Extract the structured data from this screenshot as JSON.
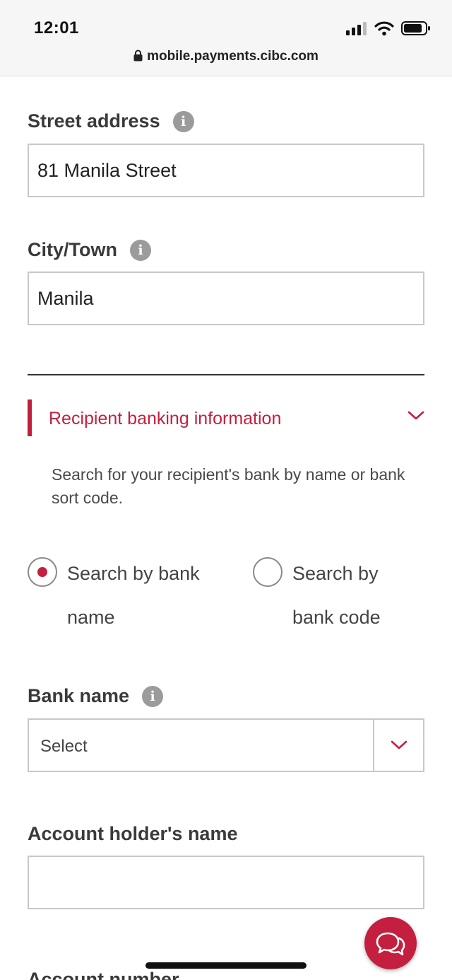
{
  "status_bar": {
    "time": "12:01"
  },
  "browser": {
    "url": "mobile.payments.cibc.com"
  },
  "form": {
    "street_address": {
      "label": "Street address",
      "value": "81 Manila Street"
    },
    "city_town": {
      "label": "City/Town",
      "value": "Manila"
    },
    "section": {
      "title": "Recipient banking information"
    },
    "helper_text": "Search for your recipient's bank by name or bank sort code.",
    "search_options": [
      {
        "label_line1": "Search by bank",
        "label_line2": "name",
        "selected": true
      },
      {
        "label_line1": "Search by",
        "label_line2": "bank code",
        "selected": false
      }
    ],
    "bank_name": {
      "label": "Bank name",
      "selected_value": "Select"
    },
    "account_holder": {
      "label": "Account holder's name",
      "value": ""
    },
    "account_number": {
      "label": "Account number"
    }
  },
  "icons": {
    "info": "info-icon",
    "chevron": "chevron-down-icon",
    "chat": "chat-icon",
    "lock": "lock-icon"
  },
  "colors": {
    "accent": "#c41f3e",
    "border": "#c8c8c8",
    "info": "#9b9b9b"
  }
}
